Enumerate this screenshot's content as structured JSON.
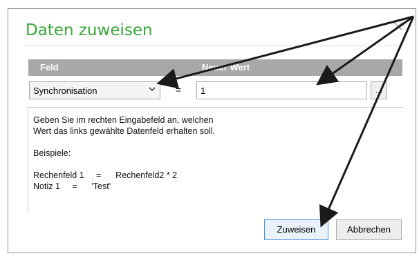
{
  "dialog": {
    "title": "Daten zuweisen",
    "close_glyph": "×"
  },
  "header": {
    "col_field": "Feld",
    "col_new_value": "Neuer Wert"
  },
  "field_select": {
    "selected": "Synchronisation"
  },
  "equals_sign": "=",
  "value_input": {
    "value": "1"
  },
  "browse_button": {
    "label": "..."
  },
  "help_text": {
    "lines": [
      "Geben Sie im rechten Eingabefeld an, welchen",
      "Wert das links gewählte Datenfeld erhalten soll.",
      "",
      "Beispiele:",
      "",
      "Rechenfeld 1     =      Rechenfeld2 * 2",
      "Notiz 1     =      'Test'"
    ]
  },
  "buttons": {
    "assign": "Zuweisen",
    "cancel": "Abbrechen"
  },
  "colors": {
    "title_green": "#3aa43a",
    "header_gray": "#a8a8a8",
    "annotation_arrows": "#1a1a1a"
  }
}
